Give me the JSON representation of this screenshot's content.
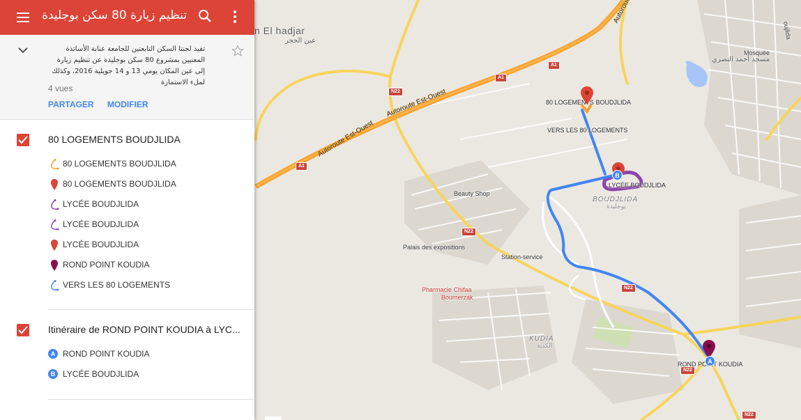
{
  "header": {
    "title": "تنظيم زيارة 80 سكن بوجليدة",
    "color": "#db4437"
  },
  "info": {
    "description": "تفيد لجنتا السكن التابعتين للجامعة عنابة الأساتذة المعنيين بمشروع 80 سكن بوجليدة عن تنظيم زيارة إلى عين المكان يومي 13 و 14 جويلية 2016، وكذلك لملء الاستمارة",
    "views": "4 vues",
    "share_label": "PARTAGER",
    "edit_label": "MODIFIER"
  },
  "layers": [
    {
      "name": "80 LOGEMENTS BOUDJLIDA",
      "features": [
        {
          "label": "80 LOGEMENTS BOUDJLIDA",
          "icon": "line-orange-icon"
        },
        {
          "label": "80 LOGEMENTS BOUDJLIDA",
          "icon": "pin-red-icon"
        },
        {
          "label": "LYCÉE BOUDJLIDA",
          "icon": "line-purple-icon"
        },
        {
          "label": "LYCÉE BOUDJLIDA",
          "icon": "line-purple-icon"
        },
        {
          "label": "LYCÉE BOUDJLIDA",
          "icon": "pin-red-icon"
        },
        {
          "label": "ROND POINT KOUDIA",
          "icon": "pin-darkred-icon"
        },
        {
          "label": "VERS LES 80 LOGEMENTS",
          "icon": "line-blue-icon"
        }
      ]
    },
    {
      "name": "Itinéraire de ROND POINT KOUDIA à LYC...",
      "features": [
        {
          "label": "ROND POINT KOUDIA",
          "icon": "marker-a-icon",
          "letter": "A"
        },
        {
          "label": "LYCÉE BOUDJLIDA",
          "icon": "marker-b-icon",
          "letter": "B"
        }
      ]
    }
  ],
  "map": {
    "labels": {
      "place_el_hadjar": "n El hadjar",
      "place_el_hadjar_ar": "عين الحجر",
      "mosquee": "Mosquée",
      "mosquee_ar": "مسجد أحمد النصري",
      "logements": "80 LOGEMENTS BOUDJLIDA",
      "vers": "VERS LES 80 LOGEMENTS",
      "lycee": "LYCÉE BOUDJLIDA",
      "boudjlida": "BOUDJLIDA",
      "boudjlida_ar": "بوجليدة",
      "beauty": "Beauty Shop",
      "palais": "Palais des expositions",
      "station": "Station-service",
      "pharmacie1": "Pharmacie Chifaa",
      "pharmacie2": "Boumerzak",
      "kudia": "KUDIA",
      "kudia_ar": "الكدية",
      "rond_point": "ROND POINT KOUDIA",
      "autoroute1": "Autoroute Est-Ouest",
      "autoroute2": "Autoroute Est-Ouest",
      "oujlida": "oujlida"
    },
    "shields": {
      "a1": "A1",
      "n22": "N22"
    },
    "route_color": "#4285f4",
    "highway_color": "#f7a02a",
    "road_color": "#f8d45c"
  }
}
